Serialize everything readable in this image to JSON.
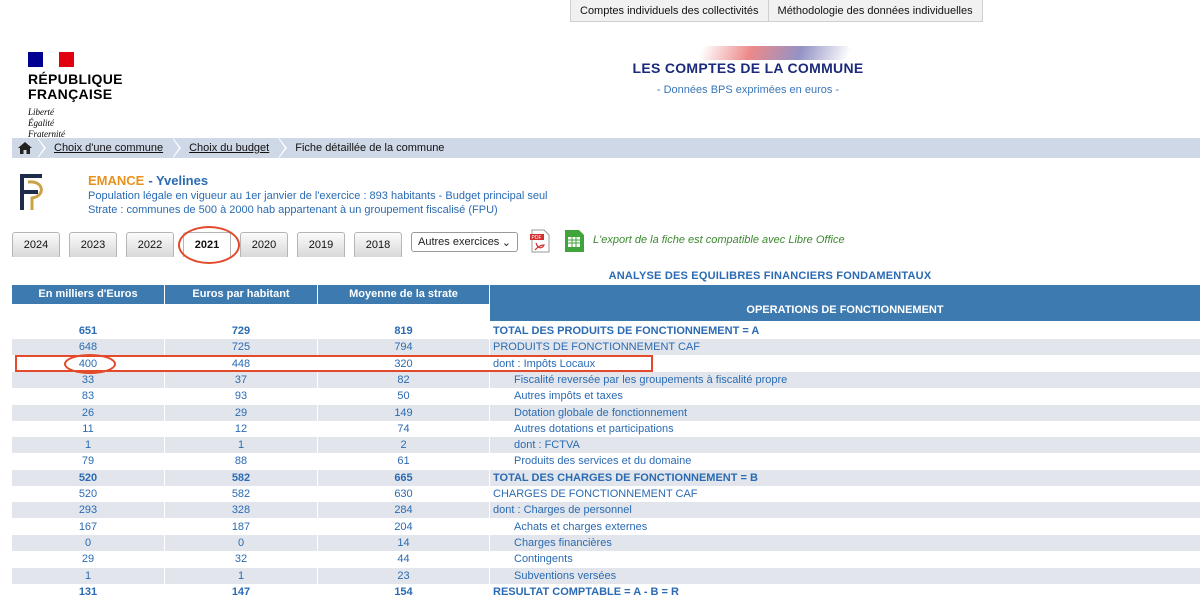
{
  "top_links": [
    "Comptes individuels des collectivités",
    "Méthodologie des données individuelles"
  ],
  "logo": {
    "lines": [
      "RÉPUBLIQUE",
      "FRANÇAISE"
    ],
    "motto": [
      "Liberté",
      "Égalité",
      "Fraternité"
    ],
    "flag_colors": [
      "#000091",
      "#ffffff",
      "#e1000f"
    ]
  },
  "header": {
    "title": "LES COMPTES DE LA COMMUNE",
    "subtitle": "- Données BPS exprimées en euros -"
  },
  "breadcrumb": {
    "home_icon": "home-icon",
    "items": [
      "Choix d'une commune",
      "Choix du budget",
      "Fiche détaillée de la commune"
    ]
  },
  "commune": {
    "name": "EMANCE",
    "dept": "- Yvelines",
    "line1": "Population légale en vigueur au 1er janvier de l'exercice : 893 habitants - Budget principal seul",
    "line2": "Strate : communes de 500 à 2000 hab appartenant à un groupement fiscalisé (FPU)"
  },
  "tabs": {
    "years": [
      "2024",
      "2023",
      "2022",
      "2021",
      "2020",
      "2019",
      "2018"
    ],
    "active": "2021",
    "other_select": "Autres exercices",
    "export_note": "L'export de la fiche est compatible avec Libre Office"
  },
  "table": {
    "title": "ANALYSE DES EQUILIBRES FINANCIERS FONDAMENTAUX",
    "col_headers": [
      "En milliers d'Euros",
      "Euros par habitant",
      "Moyenne de la strate"
    ],
    "section": "OPERATIONS DE FONCTIONNEMENT",
    "rows": [
      {
        "v1": "651",
        "v2": "729",
        "v3": "819",
        "label": "TOTAL DES PRODUITS DE FONCTIONNEMENT = A",
        "bold": true,
        "ind": false
      },
      {
        "v1": "648",
        "v2": "725",
        "v3": "794",
        "label": "PRODUITS DE FONCTIONNEMENT CAF",
        "bold": false,
        "ind": false
      },
      {
        "v1": "400",
        "v2": "448",
        "v3": "320",
        "label": "dont : Impôts Locaux",
        "bold": false,
        "ind": false
      },
      {
        "v1": "33",
        "v2": "37",
        "v3": "82",
        "label": "Fiscalité reversée par les groupements à fiscalité propre",
        "bold": false,
        "ind": true
      },
      {
        "v1": "83",
        "v2": "93",
        "v3": "50",
        "label": "Autres impôts et taxes",
        "bold": false,
        "ind": true
      },
      {
        "v1": "26",
        "v2": "29",
        "v3": "149",
        "label": "Dotation globale de fonctionnement",
        "bold": false,
        "ind": true
      },
      {
        "v1": "11",
        "v2": "12",
        "v3": "74",
        "label": "Autres dotations et participations",
        "bold": false,
        "ind": true
      },
      {
        "v1": "1",
        "v2": "1",
        "v3": "2",
        "label": "dont : FCTVA",
        "bold": false,
        "ind": true
      },
      {
        "v1": "79",
        "v2": "88",
        "v3": "61",
        "label": "Produits des services et du domaine",
        "bold": false,
        "ind": true
      },
      {
        "v1": "520",
        "v2": "582",
        "v3": "665",
        "label": "TOTAL DES CHARGES DE FONCTIONNEMENT = B",
        "bold": true,
        "ind": false
      },
      {
        "v1": "520",
        "v2": "582",
        "v3": "630",
        "label": "CHARGES DE FONCTIONNEMENT CAF",
        "bold": false,
        "ind": false
      },
      {
        "v1": "293",
        "v2": "328",
        "v3": "284",
        "label": "dont : Charges de personnel",
        "bold": false,
        "ind": false
      },
      {
        "v1": "167",
        "v2": "187",
        "v3": "204",
        "label": "Achats et charges externes",
        "bold": false,
        "ind": true
      },
      {
        "v1": "0",
        "v2": "0",
        "v3": "14",
        "label": "Charges financières",
        "bold": false,
        "ind": true
      },
      {
        "v1": "29",
        "v2": "32",
        "v3": "44",
        "label": "Contingents",
        "bold": false,
        "ind": true
      },
      {
        "v1": "1",
        "v2": "1",
        "v3": "23",
        "label": "Subventions versées",
        "bold": false,
        "ind": true
      },
      {
        "v1": "131",
        "v2": "147",
        "v3": "154",
        "label": "RESULTAT COMPTABLE = A - B = R",
        "bold": true,
        "ind": false
      }
    ]
  },
  "colors": {
    "accent": "#3d7ab0",
    "link": "#2a6bb3",
    "highlight": "#e24a2b",
    "commune": "#e8921e",
    "row_alt": "#e2e6ec"
  }
}
